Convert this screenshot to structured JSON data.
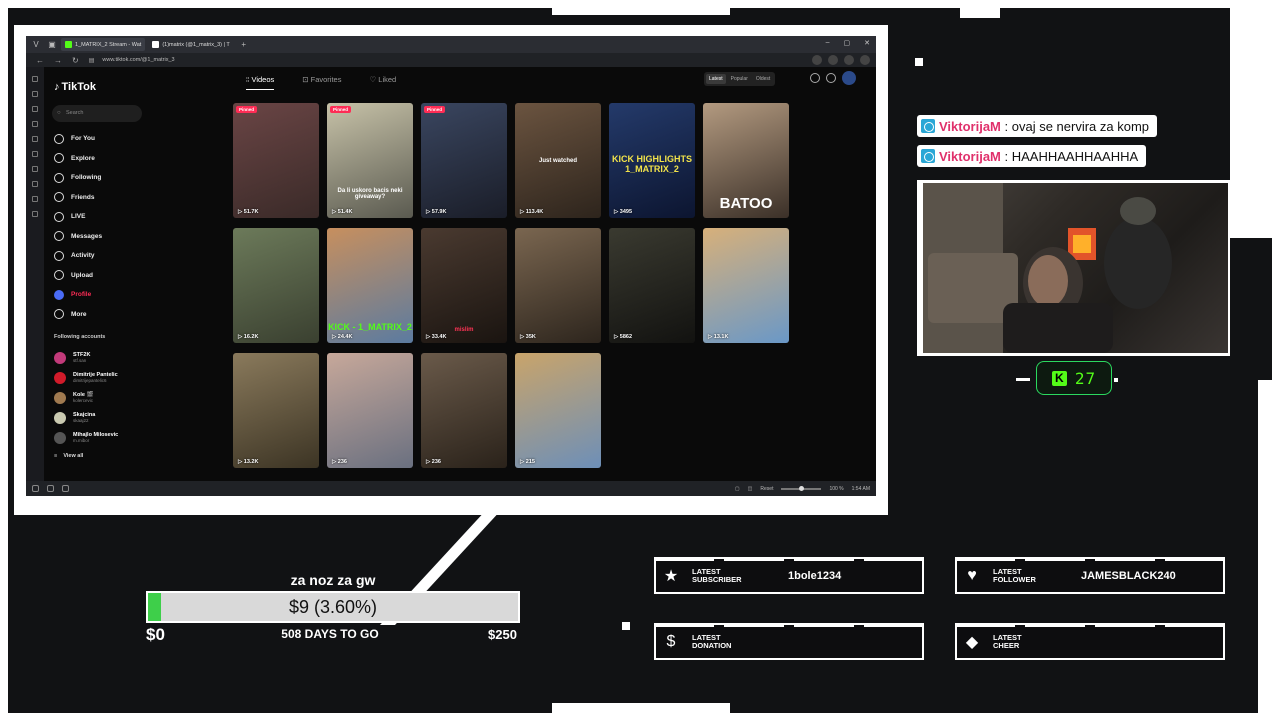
{
  "browser": {
    "tabs": [
      {
        "label": "1_MATRIX_2 Stream - Wat",
        "active": true,
        "color": "#53fc18"
      },
      {
        "label": "(1)matrix (@1_matrix_3) | T",
        "active": false,
        "color": "#ffffff"
      }
    ],
    "url": "www.tiktok.com/@1_matrix_3",
    "status": {
      "reset": "Reset",
      "zoom": "100 %",
      "time": "1:54 AM"
    }
  },
  "tiktok": {
    "logo": "TikTok",
    "search_placeholder": "Search",
    "nav": [
      {
        "label": "For You",
        "icon": "home-icon"
      },
      {
        "label": "Explore",
        "icon": "compass-icon"
      },
      {
        "label": "Following",
        "icon": "following-icon"
      },
      {
        "label": "Friends",
        "icon": "friends-icon"
      },
      {
        "label": "LIVE",
        "icon": "live-icon"
      },
      {
        "label": "Messages",
        "icon": "messages-icon"
      },
      {
        "label": "Activity",
        "icon": "activity-icon"
      },
      {
        "label": "Upload",
        "icon": "upload-icon"
      },
      {
        "label": "Profile",
        "icon": "profile-icon"
      },
      {
        "label": "More",
        "icon": "more-icon"
      }
    ],
    "following_header": "Following accounts",
    "following": [
      {
        "name": "STF2K",
        "handle": "stf.san",
        "color": "#c23a7a"
      },
      {
        "name": "Dimitrije Pantelic",
        "handle": "dimitrijepantelic6",
        "color": "#d11b2a"
      },
      {
        "name": "Kole 🎬",
        "handle": "kolercevic",
        "color": "#a07a50"
      },
      {
        "name": "Skajcina",
        "handle": "skaaj22",
        "color": "#c9c9b0"
      },
      {
        "name": "Mihajlo Milosevic",
        "handle": "m.mibor",
        "color": "#555555"
      }
    ],
    "view_all": "View all",
    "tabs": [
      "Videos",
      "Favorites",
      "Liked"
    ],
    "sort": [
      "Latest",
      "Popular",
      "Oldest"
    ],
    "videos": [
      {
        "views": "51.7K",
        "pinned": "Pinned",
        "c1": "#6a4545",
        "c2": "#3a2a28"
      },
      {
        "views": "51.4K",
        "pinned": "Pinned",
        "c1": "#c7c2a8",
        "c2": "#5a5a50",
        "caption": "Da li uskoro bacis neki giveaway?"
      },
      {
        "views": "57.9K",
        "pinned": "Pinned",
        "c1": "#3a4660",
        "c2": "#1a1d28"
      },
      {
        "views": "113.4K",
        "pinned": "",
        "c1": "#6b5440",
        "c2": "#2d241c",
        "caption": "Just watched"
      },
      {
        "views": "3495",
        "pinned": "",
        "c1": "#243a6a",
        "c2": "#0c1530",
        "caption": "KICK HIGHLIGHTS 1_MATRIX_2"
      },
      {
        "views": "",
        "pinned": "",
        "c1": "#b39a80",
        "c2": "#3b3028",
        "caption": "BATOO"
      },
      {
        "views": "16.2K",
        "pinned": "",
        "c1": "#6c7a5a",
        "c2": "#3a4030"
      },
      {
        "views": "24.4K",
        "pinned": "",
        "c1": "#c78f5e",
        "c2": "#5b7ba0",
        "caption": "KICK - 1_MATRIX_2"
      },
      {
        "views": "33.4K",
        "pinned": "",
        "c1": "#4a3a30",
        "c2": "#1a1410",
        "caption": "mislim"
      },
      {
        "views": "35K",
        "pinned": "",
        "c1": "#7a6650",
        "c2": "#2d251d"
      },
      {
        "views": "5862",
        "pinned": "",
        "c1": "#3a3a30",
        "c2": "#121210"
      },
      {
        "views": "13.1K",
        "pinned": "",
        "c1": "#d7b07a",
        "c2": "#6a98c7"
      },
      {
        "views": "13.2K",
        "pinned": "",
        "c1": "#8a7a5c",
        "c2": "#3c3424"
      },
      {
        "views": "236",
        "pinned": "",
        "c1": "#c7a89a",
        "c2": "#6a7080"
      },
      {
        "views": "236",
        "pinned": "",
        "c1": "#6a5a4a",
        "c2": "#2a221a"
      },
      {
        "views": "215",
        "pinned": "",
        "c1": "#c9a46a",
        "c2": "#6d8fb8"
      }
    ]
  },
  "chat": [
    {
      "user": "ViktorijaM",
      "text": ": ovaj se nervira za komp"
    },
    {
      "user": "ViktorijaM",
      "text": ": HAAHHAAHHAAHHA"
    }
  ],
  "viewers": {
    "icon": "kick-icon",
    "count": "27"
  },
  "goal": {
    "title": "za noz za gw",
    "progress_text": "$9 (3.60%)",
    "progress_fraction": 0.036,
    "min": "$0",
    "max": "$250",
    "days_left": "508 DAYS TO GO"
  },
  "events": {
    "subscriber": {
      "label": "LATEST SUBSCRIBER",
      "label1": "LATEST",
      "label2": "SUBSCRIBER",
      "value": "1bole1234"
    },
    "follower": {
      "label1": "LATEST",
      "label2": "FOLLOWER",
      "value": "JAMESBLACK240"
    },
    "donation": {
      "label1": "LATEST",
      "label2": "DONATION",
      "value": ""
    },
    "cheer": {
      "label1": "LATEST",
      "label2": "CHEER",
      "value": ""
    }
  },
  "colors": {
    "accent": "#fe2c55",
    "kick": "#53fc18",
    "overlay_bg": "#111214"
  }
}
